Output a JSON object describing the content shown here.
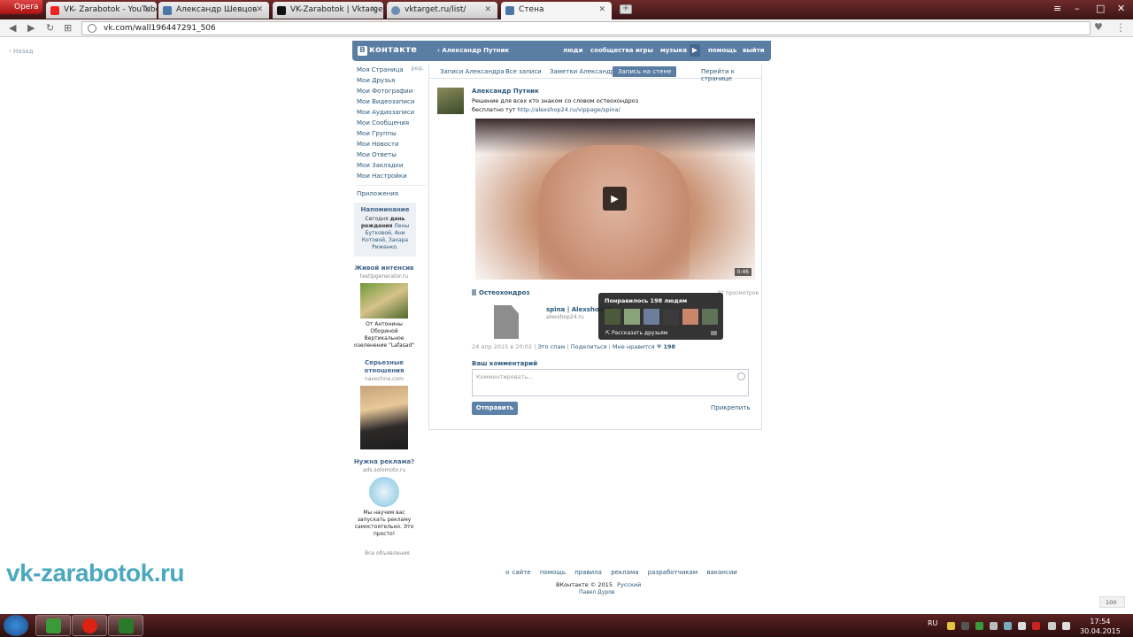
{
  "browser": {
    "opera_label": "Opera",
    "tabs": [
      {
        "title": "VK- Zarabotok - YouTube",
        "color": "#e22"
      },
      {
        "title": "Александр Шевцов",
        "color": "#4a76a8"
      },
      {
        "title": "VK-Zarabotok | Vktarget",
        "color": "#111"
      },
      {
        "title": "vktarget.ru/list/",
        "color": "#6b8fb3"
      },
      {
        "title": "Стена",
        "color": "#4a76a8"
      }
    ],
    "url": "vk.com/wall196447291_506",
    "new_tab": "+"
  },
  "page": {
    "back_label": "Назад",
    "header": {
      "logo": "контакте",
      "logo_b": "В",
      "user": "Александр Путник",
      "nav": [
        "люди",
        "сообщества",
        "игры",
        "музыка",
        "помощь",
        "выйти"
      ]
    },
    "left_menu": {
      "edit": "ред.",
      "items": [
        "Моя Страница",
        "Мои Друзья",
        "Мои Фотографии",
        "Мои Видеозаписи",
        "Мои Аудиозаписи",
        "Мои Сообщения",
        "Мои Группы",
        "Мои Новости",
        "Мои Ответы",
        "Мои Закладки",
        "Мои Настройки"
      ],
      "apps": "Приложения"
    },
    "reminder": {
      "title": "Напоминание",
      "pre": "Сегодня",
      "bold": "день рождения",
      "links": "Лены Бутковой, Ани Котовой, Захара Риженко."
    },
    "ads": [
      {
        "title": "Живой интенсив",
        "domain": "testlpgenerator.ru",
        "text": "От Антонины Обориной Вертикальное озеленение \"Lafasad\""
      },
      {
        "title": "Серьезные отношения",
        "domain": "navechno.com",
        "text": ""
      },
      {
        "title": "Нужна реклама?",
        "domain": "ads.solomoto.ru",
        "text": "Мы научим вас запускать рекламу самостоятельно. Это просто!"
      }
    ],
    "all_ads": "Все объявления",
    "wall": {
      "tabs": [
        "Записи Александра",
        "Все записи",
        "Заметки Александра",
        "Запись на стене",
        "Перейти к странице"
      ],
      "post": {
        "author": "Александр Путник",
        "line1": "Решение для всех кто знаком со словом остеохондроз",
        "line2_prefix": "бесплатно тут",
        "line2_link": "http://alexshop24.ru/vippage/spina/",
        "video_duration": "0:46",
        "video_title": "Остеохондроз",
        "views": "30 просмотров",
        "share_title": "spina | Alexshop24",
        "share_site": "alexshop24.ru",
        "date": "24 апр 2015 в 20:02",
        "spam": "Это спам",
        "share": "Поделиться",
        "like": "Мне нравится",
        "likes_count": "198"
      },
      "tooltip": {
        "title": "Понравилось 198 людям",
        "share": "Рассказать друзьям",
        "avatar_colors": [
          "#4b5a3a",
          "#8aa37a",
          "#6d7e9c",
          "#3b3b3b",
          "#c9866b",
          "#5f7357"
        ]
      },
      "comment_label": "Ваш комментарий",
      "comment_placeholder": "Комментировать...",
      "send": "Отправить",
      "attach": "Прикрепить"
    },
    "footer": {
      "links": [
        "о сайте",
        "помощь",
        "правила",
        "реклама",
        "разработчикам",
        "вакансии"
      ],
      "copyright": "ВКонтакте © 2015",
      "language": "Русский",
      "author": "Павел Дуров"
    },
    "watermark": "vk-zarabotok.ru",
    "zoom": "100"
  },
  "taskbar": {
    "lang": "RU",
    "time": "17:54",
    "date": "30.04.2015"
  }
}
